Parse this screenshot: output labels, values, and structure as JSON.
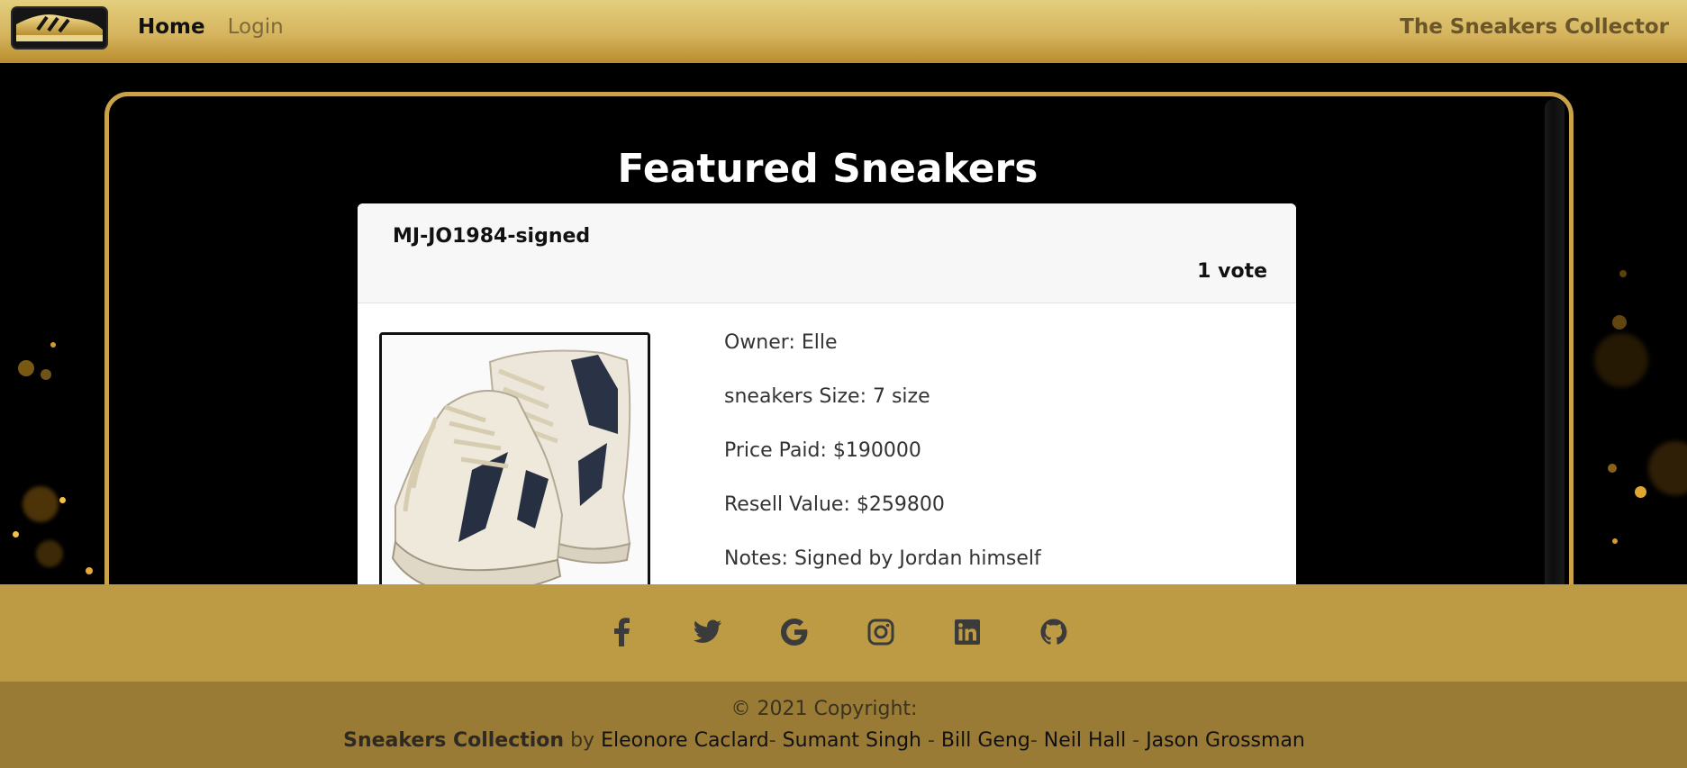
{
  "nav": {
    "home_label": "Home",
    "login_label": "Login",
    "brand": "The Sneakers Collector"
  },
  "main": {
    "title": "Featured Sneakers"
  },
  "card": {
    "name": "MJ-JO1984-signed",
    "votes": "1 vote",
    "details": [
      "Owner: Elle",
      "sneakers Size: 7 size",
      "Price Paid: $190000",
      "Resell Value: $259800",
      "Notes: Signed by Jordan himself"
    ]
  },
  "footer": {
    "social_icons": [
      "facebook-icon",
      "twitter-icon",
      "google-icon",
      "instagram-icon",
      "linkedin-icon",
      "github-icon"
    ],
    "copyright": "© 2021 Copyright:",
    "project": "Sneakers Collection",
    "by": " by ",
    "authors": [
      "Eleonore Caclard",
      "Sumant Singh",
      "Bill Geng",
      "Neil Hall",
      "Jason Grossman"
    ],
    "separators": [
      "- ",
      " - ",
      "- ",
      " - "
    ]
  },
  "colors": {
    "gold": "#bd9b44",
    "gold_dark": "#9a7b36",
    "frame": "#c9a24a"
  }
}
